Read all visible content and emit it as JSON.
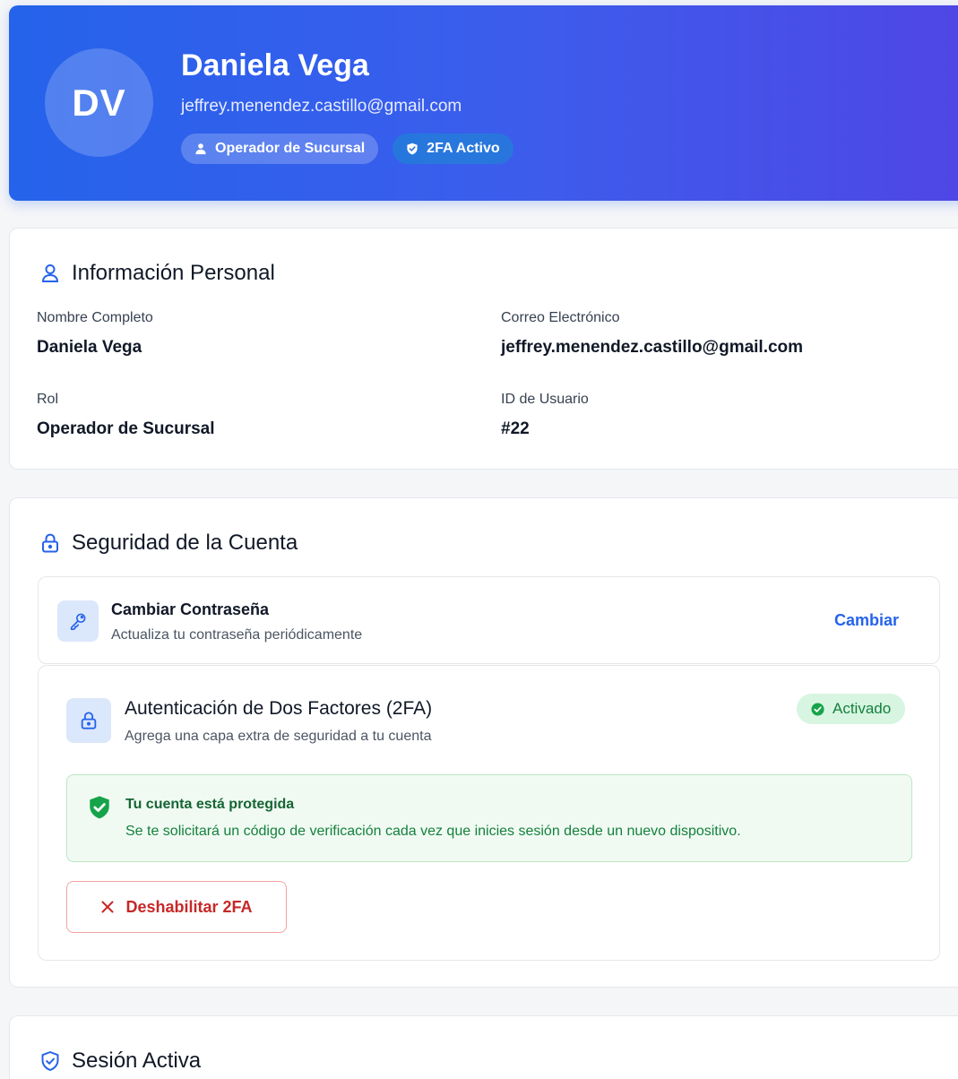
{
  "profile": {
    "initials": "DV",
    "name": "Daniela Vega",
    "email": "jeffrey.menendez.castillo@gmail.com",
    "role_chip": "Operador de Sucursal",
    "tfa_chip": "2FA Activo"
  },
  "personal_info": {
    "title": "Información Personal",
    "fields": [
      {
        "label": "Nombre Completo",
        "value": "Daniela Vega"
      },
      {
        "label": "Correo Electrónico",
        "value": "jeffrey.menendez.castillo@gmail.com"
      },
      {
        "label": "Rol",
        "value": "Operador de Sucursal"
      },
      {
        "label": "ID de Usuario",
        "value": "#22"
      }
    ]
  },
  "security": {
    "title": "Seguridad de la Cuenta",
    "password": {
      "title": "Cambiar Contraseña",
      "description": "Actualiza tu contraseña periódicamente",
      "action": "Cambiar"
    },
    "two_factor": {
      "title": "Autenticación de Dos Factores (2FA)",
      "description": "Agrega una capa extra de seguridad a tu cuenta",
      "status": "Activado",
      "protected_title": "Tu cuenta está protegida",
      "protected_description": "Se te solicitará un código de verificación cada vez que inicies sesión desde un nuevo dispositivo.",
      "disable_label": "Deshabilitar 2FA"
    }
  },
  "session": {
    "title": "Sesión Activa"
  },
  "colors": {
    "primary": "#2563eb",
    "success": "#15803d",
    "danger": "#c62828"
  }
}
